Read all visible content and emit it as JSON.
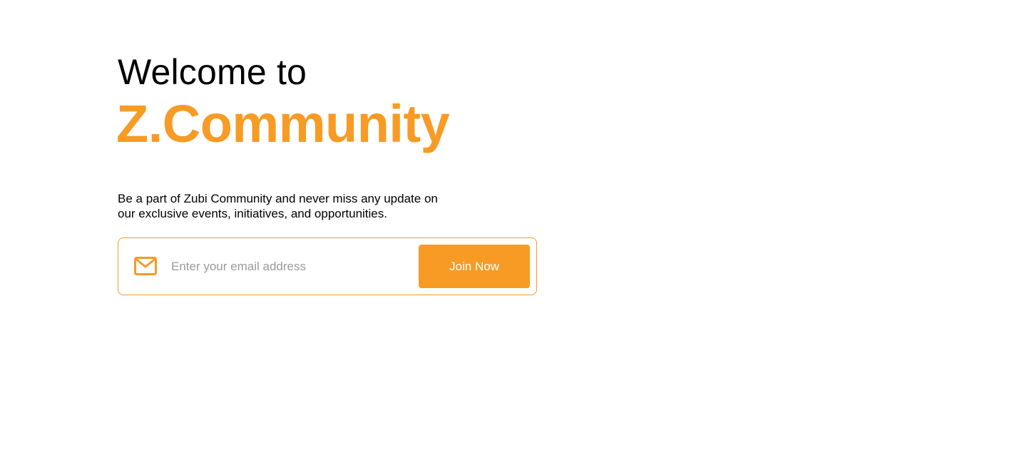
{
  "hero": {
    "welcome_text": "Welcome to",
    "brand_name": "Z.Community",
    "tagline_line1": "Be a part of Zubi Community and never miss any update on",
    "tagline_line2": "our exclusive events, initiatives, and opportunities."
  },
  "signup": {
    "icon": "mail-icon",
    "email_placeholder": "Enter your email address",
    "email_value": "",
    "join_label": "Join Now"
  },
  "colors": {
    "accent": "#f79b25",
    "text": "#000000",
    "placeholder": "#9a9a9a",
    "background": "#ffffff"
  }
}
